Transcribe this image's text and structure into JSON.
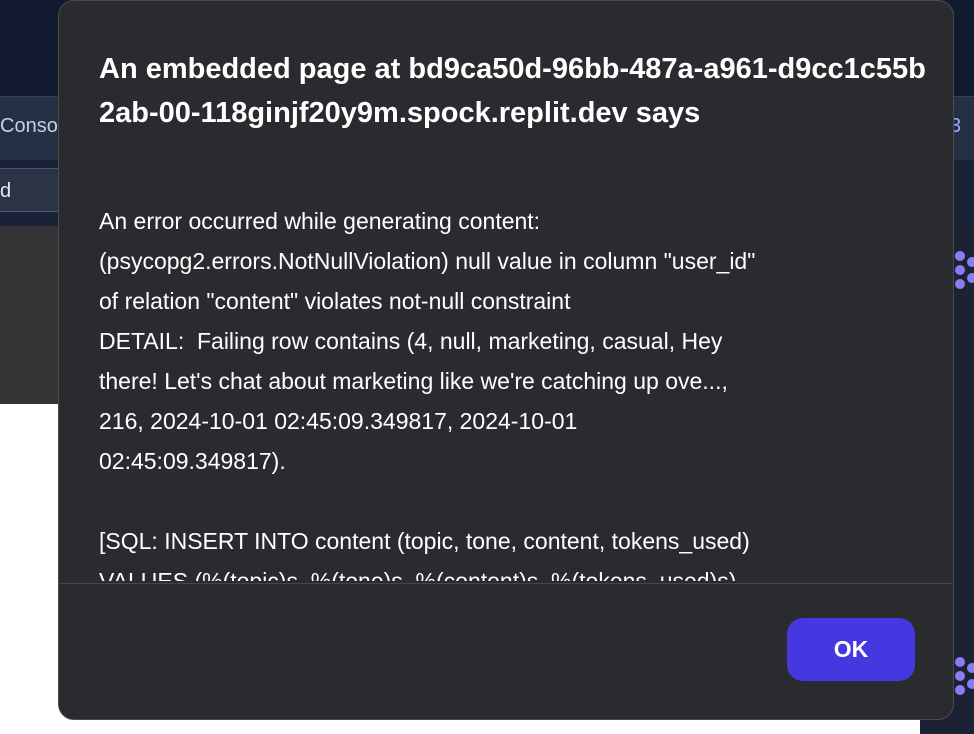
{
  "background": {
    "tab_label": "Conso",
    "tab_count": "3",
    "input_value": "d"
  },
  "dialog": {
    "title": "An embedded page at bd9ca50d-96bb-487a-a961-d9cc1c55b2ab-00-118ginjf20y9m.spock.replit.dev says",
    "lines": [
      "An error occurred while generating content:",
      "(psycopg2.errors.NotNullViolation) null value in column \"user_id\"",
      "of relation \"content\" violates not-null constraint",
      "DETAIL:  Failing row contains (4, null, marketing, casual, Hey",
      "there! Let's chat about marketing like we're catching up ove...,",
      "216, 2024-10-01 02:45:09.349817, 2024-10-01",
      "02:45:09.349817).",
      "",
      "[SQL: INSERT INTO content (topic, tone, content, tokens_used)",
      "VALUES (%(topic)s, %(tone)s, %(content)s, %(tokens_used)s)"
    ],
    "ok_label": "OK"
  },
  "colors": {
    "dialog_bg": "#2a2b2f",
    "accent": "#4538e0",
    "spinner": "#8b7cf6"
  }
}
